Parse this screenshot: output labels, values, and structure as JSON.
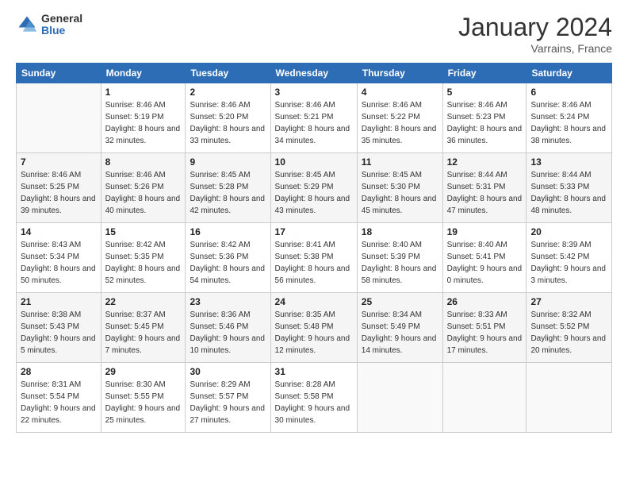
{
  "logo": {
    "general": "General",
    "blue": "Blue"
  },
  "header": {
    "title": "January 2024",
    "location": "Varrains, France"
  },
  "weekdays": [
    "Sunday",
    "Monday",
    "Tuesday",
    "Wednesday",
    "Thursday",
    "Friday",
    "Saturday"
  ],
  "weeks": [
    [
      {
        "day": "",
        "sunrise": "",
        "sunset": "",
        "daylight": ""
      },
      {
        "day": "1",
        "sunrise": "Sunrise: 8:46 AM",
        "sunset": "Sunset: 5:19 PM",
        "daylight": "Daylight: 8 hours and 32 minutes."
      },
      {
        "day": "2",
        "sunrise": "Sunrise: 8:46 AM",
        "sunset": "Sunset: 5:20 PM",
        "daylight": "Daylight: 8 hours and 33 minutes."
      },
      {
        "day": "3",
        "sunrise": "Sunrise: 8:46 AM",
        "sunset": "Sunset: 5:21 PM",
        "daylight": "Daylight: 8 hours and 34 minutes."
      },
      {
        "day": "4",
        "sunrise": "Sunrise: 8:46 AM",
        "sunset": "Sunset: 5:22 PM",
        "daylight": "Daylight: 8 hours and 35 minutes."
      },
      {
        "day": "5",
        "sunrise": "Sunrise: 8:46 AM",
        "sunset": "Sunset: 5:23 PM",
        "daylight": "Daylight: 8 hours and 36 minutes."
      },
      {
        "day": "6",
        "sunrise": "Sunrise: 8:46 AM",
        "sunset": "Sunset: 5:24 PM",
        "daylight": "Daylight: 8 hours and 38 minutes."
      }
    ],
    [
      {
        "day": "7",
        "sunrise": "Sunrise: 8:46 AM",
        "sunset": "Sunset: 5:25 PM",
        "daylight": "Daylight: 8 hours and 39 minutes."
      },
      {
        "day": "8",
        "sunrise": "Sunrise: 8:46 AM",
        "sunset": "Sunset: 5:26 PM",
        "daylight": "Daylight: 8 hours and 40 minutes."
      },
      {
        "day": "9",
        "sunrise": "Sunrise: 8:45 AM",
        "sunset": "Sunset: 5:28 PM",
        "daylight": "Daylight: 8 hours and 42 minutes."
      },
      {
        "day": "10",
        "sunrise": "Sunrise: 8:45 AM",
        "sunset": "Sunset: 5:29 PM",
        "daylight": "Daylight: 8 hours and 43 minutes."
      },
      {
        "day": "11",
        "sunrise": "Sunrise: 8:45 AM",
        "sunset": "Sunset: 5:30 PM",
        "daylight": "Daylight: 8 hours and 45 minutes."
      },
      {
        "day": "12",
        "sunrise": "Sunrise: 8:44 AM",
        "sunset": "Sunset: 5:31 PM",
        "daylight": "Daylight: 8 hours and 47 minutes."
      },
      {
        "day": "13",
        "sunrise": "Sunrise: 8:44 AM",
        "sunset": "Sunset: 5:33 PM",
        "daylight": "Daylight: 8 hours and 48 minutes."
      }
    ],
    [
      {
        "day": "14",
        "sunrise": "Sunrise: 8:43 AM",
        "sunset": "Sunset: 5:34 PM",
        "daylight": "Daylight: 8 hours and 50 minutes."
      },
      {
        "day": "15",
        "sunrise": "Sunrise: 8:42 AM",
        "sunset": "Sunset: 5:35 PM",
        "daylight": "Daylight: 8 hours and 52 minutes."
      },
      {
        "day": "16",
        "sunrise": "Sunrise: 8:42 AM",
        "sunset": "Sunset: 5:36 PM",
        "daylight": "Daylight: 8 hours and 54 minutes."
      },
      {
        "day": "17",
        "sunrise": "Sunrise: 8:41 AM",
        "sunset": "Sunset: 5:38 PM",
        "daylight": "Daylight: 8 hours and 56 minutes."
      },
      {
        "day": "18",
        "sunrise": "Sunrise: 8:40 AM",
        "sunset": "Sunset: 5:39 PM",
        "daylight": "Daylight: 8 hours and 58 minutes."
      },
      {
        "day": "19",
        "sunrise": "Sunrise: 8:40 AM",
        "sunset": "Sunset: 5:41 PM",
        "daylight": "Daylight: 9 hours and 0 minutes."
      },
      {
        "day": "20",
        "sunrise": "Sunrise: 8:39 AM",
        "sunset": "Sunset: 5:42 PM",
        "daylight": "Daylight: 9 hours and 3 minutes."
      }
    ],
    [
      {
        "day": "21",
        "sunrise": "Sunrise: 8:38 AM",
        "sunset": "Sunset: 5:43 PM",
        "daylight": "Daylight: 9 hours and 5 minutes."
      },
      {
        "day": "22",
        "sunrise": "Sunrise: 8:37 AM",
        "sunset": "Sunset: 5:45 PM",
        "daylight": "Daylight: 9 hours and 7 minutes."
      },
      {
        "day": "23",
        "sunrise": "Sunrise: 8:36 AM",
        "sunset": "Sunset: 5:46 PM",
        "daylight": "Daylight: 9 hours and 10 minutes."
      },
      {
        "day": "24",
        "sunrise": "Sunrise: 8:35 AM",
        "sunset": "Sunset: 5:48 PM",
        "daylight": "Daylight: 9 hours and 12 minutes."
      },
      {
        "day": "25",
        "sunrise": "Sunrise: 8:34 AM",
        "sunset": "Sunset: 5:49 PM",
        "daylight": "Daylight: 9 hours and 14 minutes."
      },
      {
        "day": "26",
        "sunrise": "Sunrise: 8:33 AM",
        "sunset": "Sunset: 5:51 PM",
        "daylight": "Daylight: 9 hours and 17 minutes."
      },
      {
        "day": "27",
        "sunrise": "Sunrise: 8:32 AM",
        "sunset": "Sunset: 5:52 PM",
        "daylight": "Daylight: 9 hours and 20 minutes."
      }
    ],
    [
      {
        "day": "28",
        "sunrise": "Sunrise: 8:31 AM",
        "sunset": "Sunset: 5:54 PM",
        "daylight": "Daylight: 9 hours and 22 minutes."
      },
      {
        "day": "29",
        "sunrise": "Sunrise: 8:30 AM",
        "sunset": "Sunset: 5:55 PM",
        "daylight": "Daylight: 9 hours and 25 minutes."
      },
      {
        "day": "30",
        "sunrise": "Sunrise: 8:29 AM",
        "sunset": "Sunset: 5:57 PM",
        "daylight": "Daylight: 9 hours and 27 minutes."
      },
      {
        "day": "31",
        "sunrise": "Sunrise: 8:28 AM",
        "sunset": "Sunset: 5:58 PM",
        "daylight": "Daylight: 9 hours and 30 minutes."
      },
      {
        "day": "",
        "sunrise": "",
        "sunset": "",
        "daylight": ""
      },
      {
        "day": "",
        "sunrise": "",
        "sunset": "",
        "daylight": ""
      },
      {
        "day": "",
        "sunrise": "",
        "sunset": "",
        "daylight": ""
      }
    ]
  ]
}
